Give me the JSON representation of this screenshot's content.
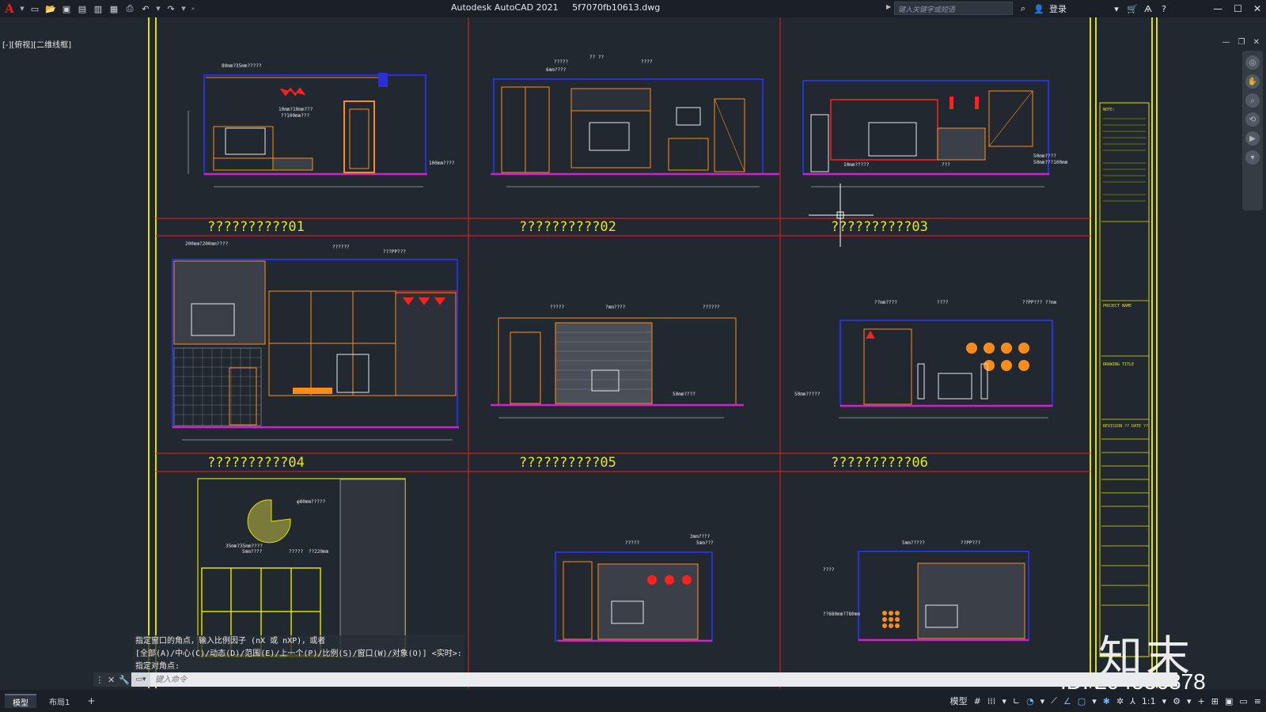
{
  "app": {
    "title": "Autodesk AutoCAD 2021",
    "filename": "5f7070fb10613.dwg",
    "logo": "A"
  },
  "titlebar": {
    "search_placeholder": "键入关键字或短语",
    "login_label": "登录",
    "icons": [
      "new-icon",
      "open-icon",
      "save-icon",
      "saveas-icon",
      "print-icon",
      "undo-icon",
      "redo-icon"
    ]
  },
  "viewport": {
    "label": "[-][俯视][二维线框]"
  },
  "drawing": {
    "panels": [
      {
        "id": "01",
        "title": "??????????01"
      },
      {
        "id": "02",
        "title": "??????????02"
      },
      {
        "id": "03",
        "title": "??????????03"
      },
      {
        "id": "04",
        "title": "??????????04"
      },
      {
        "id": "05",
        "title": "??????????05"
      },
      {
        "id": "06",
        "title": "??????????06"
      }
    ],
    "dims": {
      "p1": [
        "80mm?35mm?????",
        "10mm?10mm???",
        "??100mm???",
        "100mm????"
      ],
      "p2": [
        "?????",
        "6mm????",
        "????",
        "?? ??"
      ],
      "p3": [
        "50mm????",
        "50mm???100mm",
        "10mm?????",
        "???"
      ],
      "p4": [
        "200mm?200mm????",
        "??????",
        "???PP???"
      ],
      "p5": [
        "?????",
        "?mm????",
        "??????",
        "50mm????"
      ],
      "p6": [
        "??mm????",
        "????",
        "??PP??? ??mm",
        "50mm?????"
      ],
      "p7": [
        "φ80mm?????",
        "35mm?35mm????",
        "5mm????",
        "?????",
        "??220mm"
      ],
      "p8": [
        "?????",
        "3mm????",
        "5mm???"
      ],
      "p9": [
        "5mm?????",
        "??PP???",
        "??680mm?780mm",
        "????"
      ]
    },
    "title_block": {
      "notes_heading": "NOTE:",
      "project_name": "PROJECT NAME",
      "drawing_title": "DRAWING TITLE",
      "revision": "REVISION ??",
      "date": "DATE ??"
    }
  },
  "command_history": [
    "指定窗口的角点，输入比例因子 (nX 或 nXP)，或者",
    "[全部(A)/中心(C)/动态(D)/范围(E)/上一个(P)/比例(S)/窗口(W)/对象(O)] <实时>:",
    "指定对角点:"
  ],
  "command_input": {
    "placeholder": "键入命令"
  },
  "statusbar": {
    "tabs": [
      "模型",
      "布局1"
    ],
    "model_label": "模型",
    "scale_label": "1:1"
  },
  "watermark": {
    "logo": "知末",
    "id": "ID: 294536878"
  },
  "colors": {
    "background": "#212830",
    "frame_yellow": "#e0e000",
    "grid_red": "#c8201c",
    "outline_blue": "#2a30d8",
    "furniture_orange": "#ff8c1a",
    "floor_magenta": "#d020d0",
    "dim_white": "#e8e8e8",
    "title_yellow": "#e6e629"
  }
}
